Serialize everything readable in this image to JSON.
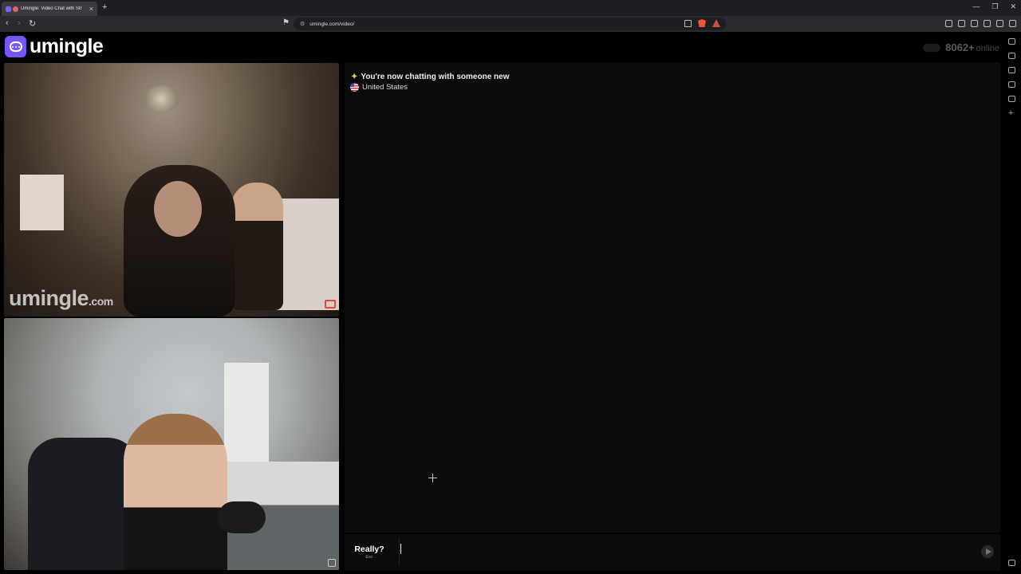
{
  "browser": {
    "tab_title": "Umingle: Video Chat with Str",
    "url": "umingle.com/video/"
  },
  "site": {
    "logo_text": "umingle",
    "online_count": "8062+",
    "online_label": "online"
  },
  "video": {
    "watermark_main": "umingle",
    "watermark_suffix": ".com"
  },
  "chat": {
    "status_message": "You're now chatting with someone new",
    "country": "United States"
  },
  "composer": {
    "skip_label": "Really?",
    "skip_hint": "Esc",
    "message_value": ""
  },
  "colors": {
    "brand": "#7655ff",
    "report": "#e24a3a"
  }
}
